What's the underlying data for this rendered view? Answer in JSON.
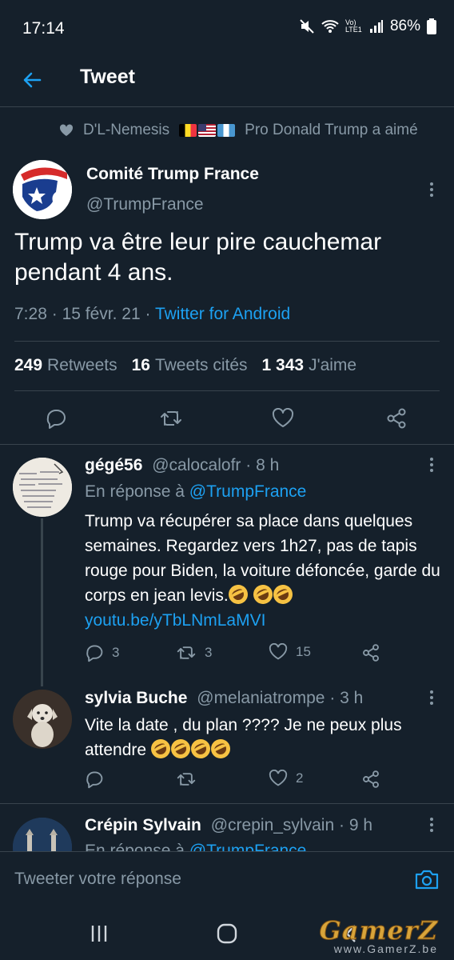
{
  "status_bar": {
    "time": "17:14",
    "network": "Vo) LTE1",
    "battery": "86%"
  },
  "header": {
    "title": "Tweet"
  },
  "liked_by": {
    "name": "D'L-Nemesis",
    "suffix": "Pro Donald Trump a aimé",
    "flags": [
      "belgium",
      "usa",
      "guatemala"
    ]
  },
  "tweet": {
    "author_name": "Comité Trump France",
    "author_handle": "@TrumpFrance",
    "text": "Trump va être leur pire cauchemar pendant 4 ans.",
    "time": "7:28",
    "date": "15 févr. 21",
    "source": "Twitter for Android",
    "retweets_count": "249",
    "retweets_label": "Retweets",
    "quotes_count": "16",
    "quotes_label": "Tweets cités",
    "likes_count": "1 343",
    "likes_label": "J'aime"
  },
  "replies": [
    {
      "name": "gégé56",
      "handle": "@calocalofr",
      "time": "8 h",
      "reply_to_prefix": "En réponse à",
      "reply_to": "@TrumpFrance",
      "text": "Trump va récupérer sa place dans quelques semaines. Regardez vers 1h27, pas de tapis rouge pour Biden, la voiture défoncée, garde du corps en jean levis.",
      "link": "youtu.be/yTbLNmLaMVI",
      "reply_count": "3",
      "retweet_count": "3",
      "like_count": "15"
    },
    {
      "name": "sylvia Buche",
      "handle": "@melaniatrompe",
      "time": "3 h",
      "text": "Vite la date , du plan ???? Je ne peux plus attendre",
      "reply_count": "",
      "retweet_count": "",
      "like_count": "2"
    },
    {
      "name": "Crépin Sylvain",
      "handle": "@crepin_sylvain",
      "time": "9 h",
      "reply_to_prefix": "En réponse à",
      "reply_to": "@TrumpFrance"
    }
  ],
  "reply_bar": {
    "placeholder": "Tweeter votre réponse"
  },
  "watermark": {
    "logo": "GamerZ",
    "url": "www.GamerZ.be"
  },
  "colors": {
    "background": "#15202b",
    "accent": "#1da1f2",
    "muted": "#8899a6",
    "divider": "#38444d"
  }
}
